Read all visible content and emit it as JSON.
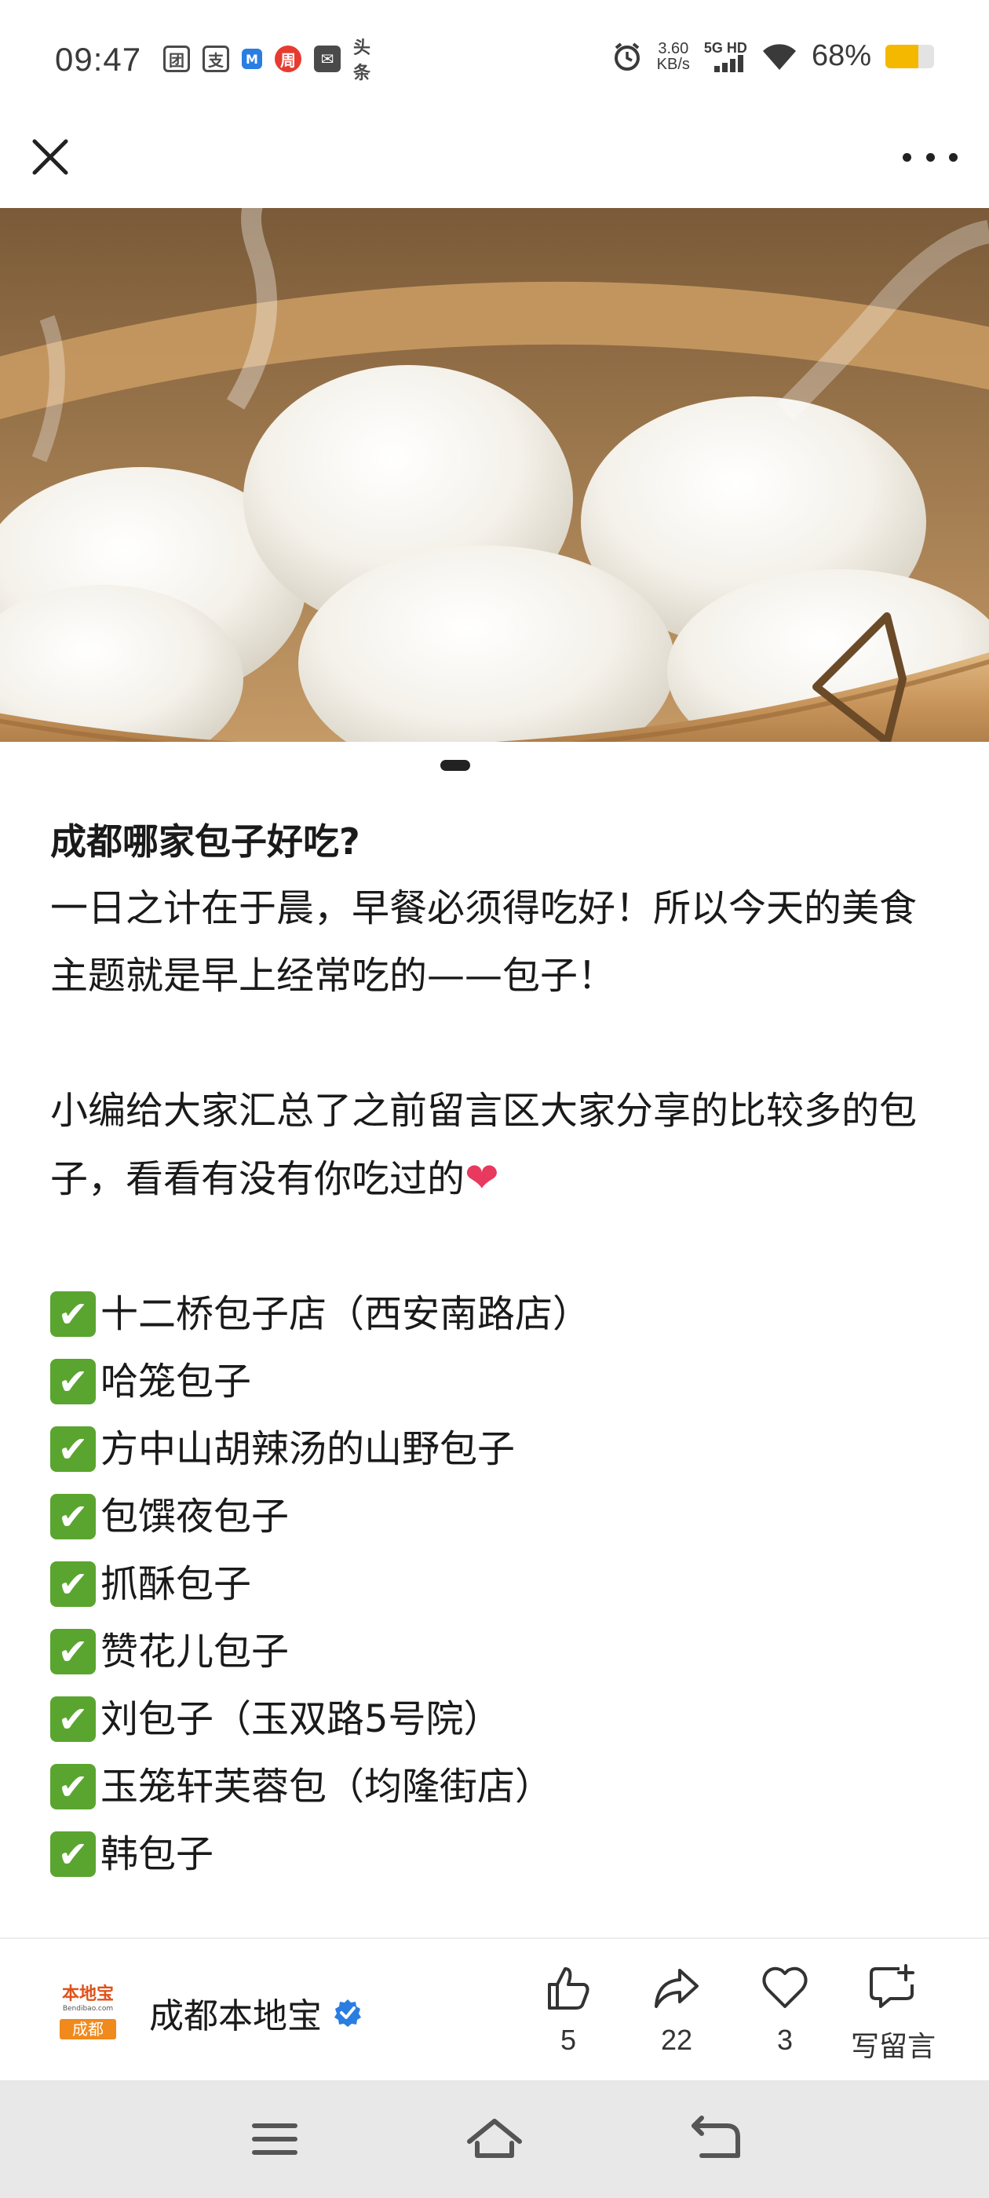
{
  "status_bar": {
    "time": "09:47",
    "left_icons": [
      {
        "icon": "meituan-icon",
        "glyph": "团"
      },
      {
        "icon": "alipay-icon",
        "glyph": "支"
      },
      {
        "icon": "m-app-icon",
        "glyph": "M"
      },
      {
        "icon": "promo-app-icon",
        "glyph": "周"
      },
      {
        "icon": "message-icon",
        "glyph": "✉"
      },
      {
        "icon": "toutiao-icon",
        "glyph": "头条"
      }
    ],
    "speed_value": "3.60",
    "speed_unit": "KB/s",
    "network": "5G HD",
    "battery_percent": "68%",
    "battery_level": 0.68,
    "battery_color": "#f5b800"
  },
  "article": {
    "title": "成都哪家包子好吃?",
    "paragraph1": "一日之计在于晨，早餐必须得吃好！所以今天的美食主题就是早上经常吃的——包子！",
    "paragraph2": "小编给大家汇总了之前留言区大家分享的比较多的包子，看看有没有你吃过的",
    "heart_emoji": "❤",
    "check_mark": "✔",
    "list": [
      "十二桥包子店（西安南路店）",
      "哈笼包子",
      "方中山胡辣汤的山野包子",
      "包馔夜包子",
      "抓酥包子",
      "赞花儿包子",
      "刘包子（玉双路5号院）",
      "玉笼轩芙蓉包（均隆街店）",
      "韩包子"
    ]
  },
  "author": {
    "name": "成都本地宝",
    "logo_top": "本地宝",
    "logo_url": "Bendibao.com",
    "logo_city": "成都"
  },
  "actions": {
    "like_count": "5",
    "share_count": "22",
    "favorite_count": "3",
    "comment_label": "写留言"
  },
  "colors": {
    "check_green": "#5aa52f",
    "heart_red": "#e8395e",
    "verified_blue": "#2a7de1",
    "logo_orange": "#f08a1c"
  }
}
